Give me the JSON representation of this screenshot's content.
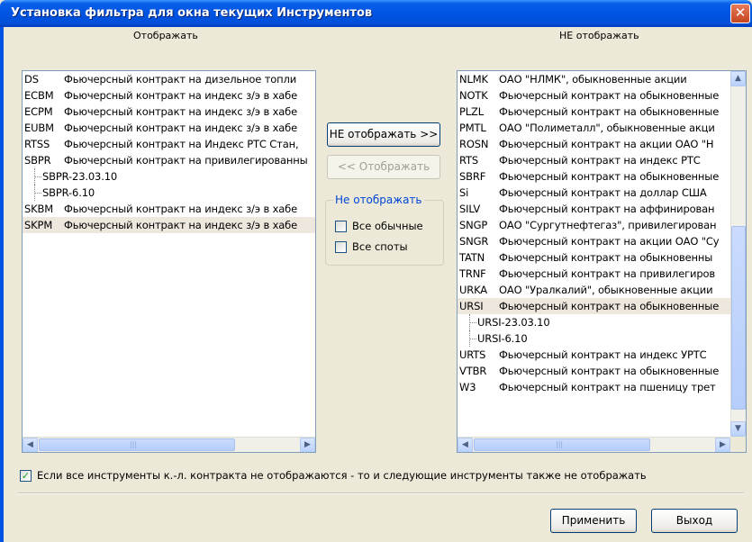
{
  "window": {
    "title": "Установка фильтра для окна текущих Инструментов",
    "close_glyph": "✕"
  },
  "left_list": {
    "label": "Отображать",
    "rows": [
      {
        "code": "DS",
        "desc": "Фьючерсный контракт на дизельное топли",
        "child": false,
        "selected": false
      },
      {
        "code": "ECBM",
        "desc": "Фьючерсный контракт на индекс з/э в хабе",
        "child": false,
        "selected": false
      },
      {
        "code": "ECPM",
        "desc": "Фьючерсный контракт на индекс з/э в хабе",
        "child": false,
        "selected": false
      },
      {
        "code": "EUBM",
        "desc": "Фьючерсный контракт на индекс з/э в хабе",
        "child": false,
        "selected": false
      },
      {
        "code": "RTSS",
        "desc": "Фьючерсный контракт на Индекс РТС Стан,",
        "child": false,
        "selected": false
      },
      {
        "code": "SBPR",
        "desc": "Фьючерсный контракт на привилегированны",
        "child": false,
        "selected": false
      },
      {
        "code": "SBPR-23.03.10",
        "desc": "",
        "child": true,
        "selected": false
      },
      {
        "code": "SBPR-6.10",
        "desc": "",
        "child": true,
        "selected": false
      },
      {
        "code": "SKBM",
        "desc": "Фьючерсный контракт на индекс з/э в хабе",
        "child": false,
        "selected": false
      },
      {
        "code": "SKPM",
        "desc": "Фьючерсный контракт на индекс з/э в хабе",
        "child": false,
        "selected": true
      }
    ]
  },
  "right_list": {
    "label": "НЕ отображать",
    "rows": [
      {
        "code": "NLMK",
        "desc": "ОАО \"НЛМК\", обыкновенные акции",
        "child": false,
        "selected": false
      },
      {
        "code": "NOTK",
        "desc": "Фьючерсный контракт на обыкновенные",
        "child": false,
        "selected": false
      },
      {
        "code": "PLZL",
        "desc": "Фьючерсный контракт на обыкновенные",
        "child": false,
        "selected": false
      },
      {
        "code": "PMTL",
        "desc": "ОАО \"Полиметалл\", обыкновенные акци",
        "child": false,
        "selected": false
      },
      {
        "code": "ROSN",
        "desc": "Фьючерсный контракт на акции ОАО \"Н",
        "child": false,
        "selected": false
      },
      {
        "code": "RTS",
        "desc": "Фьючерсный контракт на индекс РТС",
        "child": false,
        "selected": false
      },
      {
        "code": "SBRF",
        "desc": "Фьючерсный контракт на обыкновенные",
        "child": false,
        "selected": false
      },
      {
        "code": "Si",
        "desc": "Фьючерсный контракт на  доллар США",
        "child": false,
        "selected": false
      },
      {
        "code": "SILV",
        "desc": "Фьючерсный контракт на аффинирован",
        "child": false,
        "selected": false
      },
      {
        "code": "SNGP",
        "desc": "ОАО \"Сургутнефтегаз\", привилегирован",
        "child": false,
        "selected": false
      },
      {
        "code": "SNGR",
        "desc": "Фьючерсный контракт на акции ОАО \"Су",
        "child": false,
        "selected": false
      },
      {
        "code": "TATN",
        "desc": "Фьючерсный контракт на обыкновенны",
        "child": false,
        "selected": false
      },
      {
        "code": "TRNF",
        "desc": "Фьючерсный контракт на привилегиров",
        "child": false,
        "selected": false
      },
      {
        "code": "URKA",
        "desc": "ОАО \"Уралкалий\", обыкновенные акции",
        "child": false,
        "selected": false
      },
      {
        "code": "URSI",
        "desc": "Фьючерсный контракт на обыкновенные",
        "child": false,
        "selected": true
      },
      {
        "code": "URSI-23.03.10",
        "desc": "",
        "child": true,
        "selected": false
      },
      {
        "code": "URSI-6.10",
        "desc": "",
        "child": true,
        "selected": false
      },
      {
        "code": "URTS",
        "desc": "Фьючерсный контракт на индекс УРТС",
        "child": false,
        "selected": false
      },
      {
        "code": "VTBR",
        "desc": "Фьючерсный контракт на обыкновенные",
        "child": false,
        "selected": false
      },
      {
        "code": "W3",
        "desc": "Фьючерсный контракт на пшеницу трет",
        "child": false,
        "selected": false
      }
    ]
  },
  "buttons": {
    "hide": "НЕ отображать >>",
    "show": "<< Отображать",
    "apply": "Применить",
    "exit": "Выход"
  },
  "group": {
    "title": "Не отображать",
    "all_regular": "Все обычные",
    "all_spots": "Все споты",
    "all_regular_checked": false,
    "all_spots_checked": false
  },
  "bottom_option": {
    "label": "Если все инструменты к.-л. контракта не отображаются - то и следующие инструменты также не отображать",
    "checked": true
  },
  "scroll_glyphs": {
    "left": "◀",
    "right": "▶",
    "up": "▲",
    "down": "▼",
    "grip": "|||"
  }
}
